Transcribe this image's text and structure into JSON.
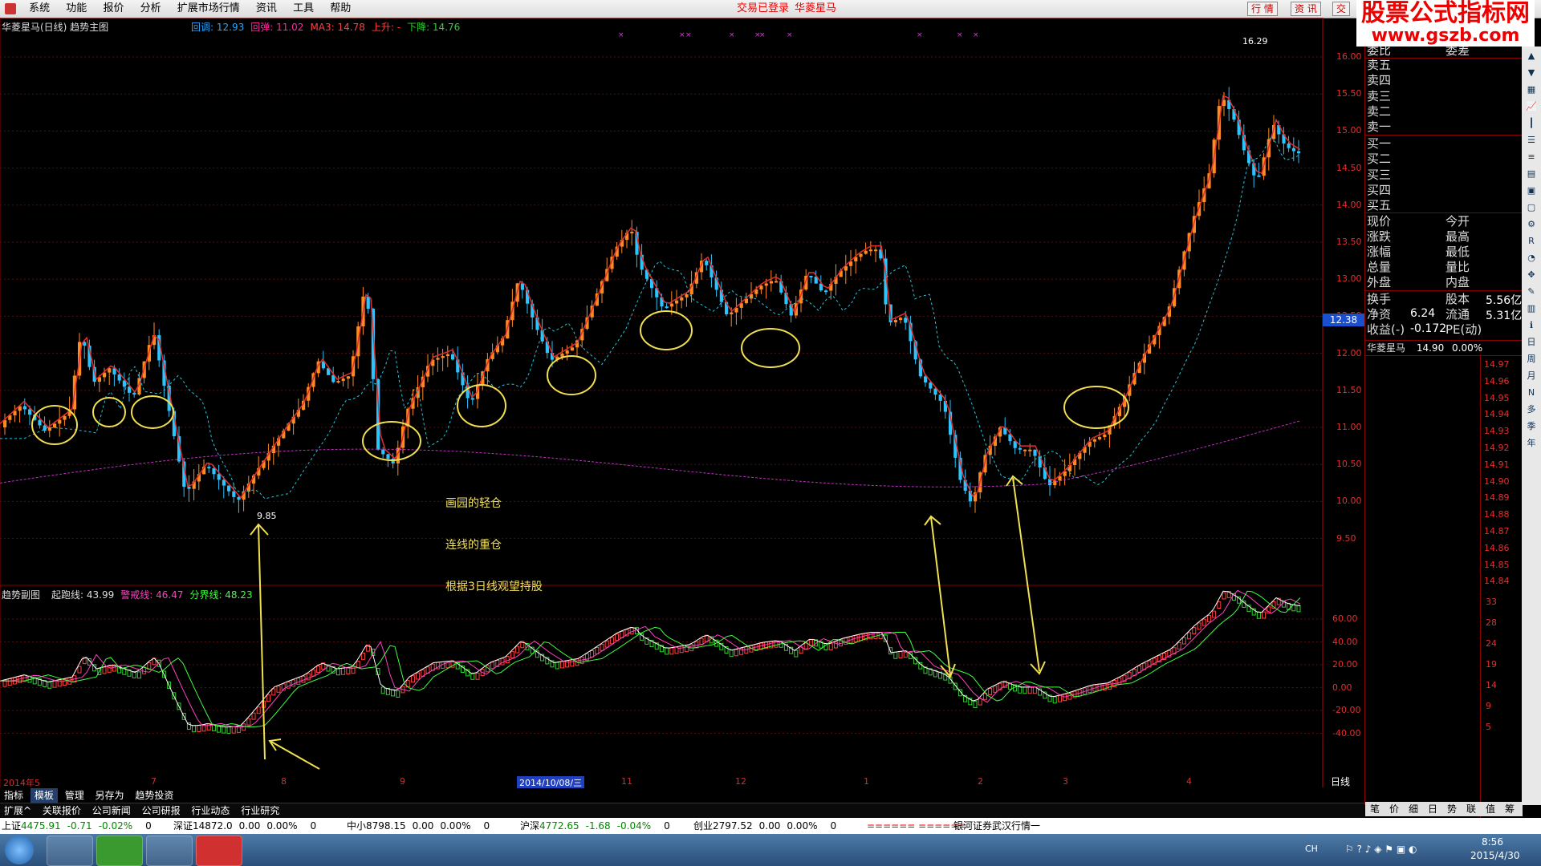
{
  "menu": {
    "items": [
      "系统",
      "功能",
      "报价",
      "分析",
      "扩展市场行情",
      "资讯",
      "工具",
      "帮助"
    ],
    "status_login": "交易已登录",
    "stock_name": "华菱星马",
    "top_buttons": [
      "行 情",
      "资 讯",
      "交"
    ]
  },
  "watermark": {
    "line1": "股票公式指标网",
    "line2": "www.gszb.com"
  },
  "main_chart": {
    "title": "华菱星马(日线) 趋势主图",
    "legend": [
      {
        "label": "回调: 12.93",
        "color": "#2aa4ff"
      },
      {
        "label": "回弹: 11.02",
        "color": "#ff2aa0"
      },
      {
        "label": "MA3: 14.78",
        "color": "#ff4040"
      },
      {
        "label": "上升: -",
        "color": "#ff4040"
      },
      {
        "label": "下降: 14.76",
        "color": "#30d030"
      }
    ],
    "y_ticks": [
      "16.00",
      "15.50",
      "15.00",
      "14.50",
      "14.00",
      "13.50",
      "13.00",
      "12.50",
      "12.00",
      "11.50",
      "11.00",
      "10.50",
      "10.00",
      "9.50"
    ],
    "price_marker": "12.38",
    "high_label": "16.29",
    "low_label": "9.85",
    "annotations": [
      "画园的轻仓",
      "连线的重仓",
      "根据3日线观望持股"
    ]
  },
  "sub_chart": {
    "title": "趋势副图",
    "legend": [
      {
        "label": "起跑线: 43.99",
        "color": "#dddddd"
      },
      {
        "label": "警戒线: 46.47",
        "color": "#ff40c0"
      },
      {
        "label": "分界线: 48.23",
        "color": "#40ff40"
      }
    ],
    "y_ticks": [
      "60.00",
      "40.00",
      "20.00",
      "0.00",
      "-20.00",
      "-40.00"
    ]
  },
  "x_axis": {
    "labels": [
      "2014年5",
      "7",
      "8",
      "9",
      "2014/10/08/三",
      "11",
      "12",
      "1",
      "2",
      "3",
      "4"
    ],
    "period": "日线"
  },
  "right_panel": {
    "header_left": "委比",
    "header_right": "委差",
    "sell": [
      "卖五",
      "卖四",
      "卖三",
      "卖二",
      "卖一"
    ],
    "buy": [
      "买一",
      "买二",
      "买三",
      "买四",
      "买五"
    ],
    "quote_rows": [
      {
        "l": "现价",
        "r": "今开"
      },
      {
        "l": "涨跌",
        "r": "最高"
      },
      {
        "l": "涨幅",
        "r": "最低"
      },
      {
        "l": "总量",
        "r": "量比"
      },
      {
        "l": "外盘",
        "r": "内盘"
      }
    ],
    "fin_rows": [
      {
        "l": "换手",
        "r": "股本",
        "rv": "5.56亿"
      },
      {
        "l": "净资",
        "lv": "6.24",
        "r": "流通",
        "rv": "5.31亿"
      },
      {
        "l": "收益(-)",
        "lv": "-0.172",
        "r": "PE(动)",
        "rv": ""
      }
    ],
    "tick_header": {
      "name": "华菱星马",
      "price": "14.90",
      "pct": "0.00%"
    },
    "tick_prices": [
      "14.97",
      "14.96",
      "14.95",
      "14.94",
      "14.93",
      "14.92",
      "14.91",
      "14.90",
      "14.89",
      "14.88",
      "14.87",
      "14.86",
      "14.85",
      "14.84"
    ],
    "vol_ticks": [
      "33",
      "28",
      "24",
      "19",
      "14",
      "9",
      "5"
    ],
    "bottom_tabs": [
      "笔",
      "价",
      "细",
      "日",
      "势",
      "联",
      "值",
      "筹"
    ]
  },
  "toolstrip": [
    "日",
    "周",
    "月",
    "N",
    "多",
    "季",
    "年"
  ],
  "bottom_tabs1": [
    "指标",
    "模板",
    "管理",
    "另存为",
    "趋势投资"
  ],
  "bottom_tabs2": [
    "扩展^",
    "关联报价",
    "公司新闻",
    "公司研报",
    "行业动态",
    "行业研究"
  ],
  "quotes": [
    {
      "name": "上证",
      "val": "4475.91",
      "chg": "-0.71",
      "pct": "-0.02%",
      "vol": "0"
    },
    {
      "name": "深证",
      "val": "14872.0",
      "chg": "0.00",
      "pct": "0.00%",
      "vol": "0"
    },
    {
      "name": "中小",
      "val": "8798.15",
      "chg": "0.00",
      "pct": "0.00%",
      "vol": "0"
    },
    {
      "name": "沪深",
      "val": "4772.65",
      "chg": "-1.68",
      "pct": "-0.04%",
      "vol": "0"
    },
    {
      "name": "创业",
      "val": "2797.52",
      "chg": "0.00",
      "pct": "0.00%",
      "vol": "0"
    }
  ],
  "ticker_text": "====== ======",
  "news_text": "银河证券武汉行情一",
  "taskbar": {
    "time": "8:56",
    "date": "2015/4/30",
    "lang": "CH"
  }
}
